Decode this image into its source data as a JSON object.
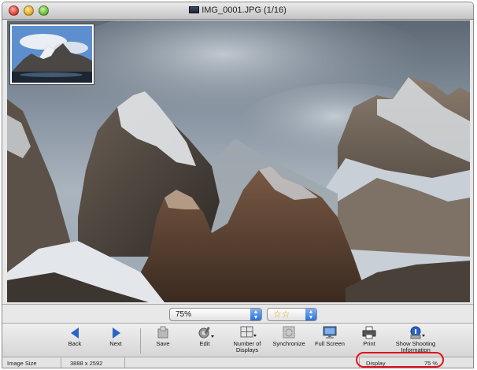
{
  "window": {
    "title": "IMG_0001.JPG (1/16)"
  },
  "viewer": {
    "zoom_value": "75%",
    "rating_value": "☆☆"
  },
  "toolbar": {
    "back": "Back",
    "next": "Next",
    "save": "Save",
    "edit": "Edit",
    "number_of_displays_line1": "Number of",
    "number_of_displays_line2": "Displays",
    "synchronize": "Synchronize",
    "full_screen": "Full Screen",
    "print": "Print",
    "show_shooting_line1": "Show Shooting",
    "show_shooting_line2": "Information"
  },
  "status": {
    "image_size_label": "Image Size",
    "image_size_value": "3888 x 2592",
    "display_label": "Display",
    "display_value": "75 %"
  },
  "colors": {
    "accent_blue": "#2a64c9",
    "highlight_red": "#e0141c"
  }
}
